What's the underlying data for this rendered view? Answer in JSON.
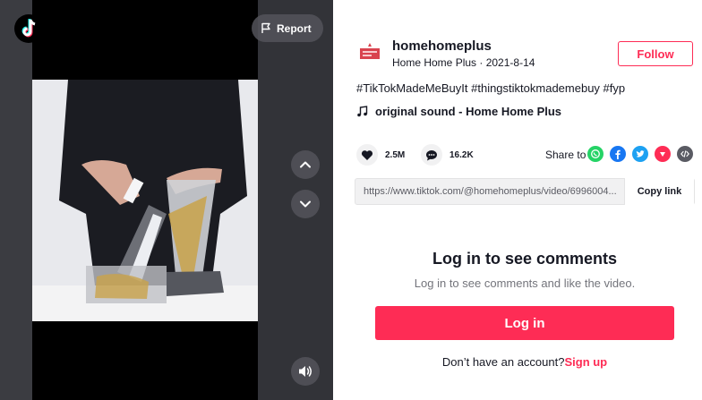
{
  "video": {
    "report_label": "Report",
    "logo_icon": "tiktok-logo-icon",
    "nav_up_icon": "chevron-up-icon",
    "nav_down_icon": "chevron-down-icon",
    "volume_icon": "volume-icon"
  },
  "author": {
    "username": "homehomeplus",
    "display_name": "Home Home Plus",
    "date": "2021-8-14",
    "separator": " · "
  },
  "follow_label": "Follow",
  "caption": "#TikTokMadeMeBuyIt #thingstiktokmademebuy #fyp",
  "music": {
    "icon": "music-note-icon",
    "title": "original sound - Home Home Plus"
  },
  "stats": {
    "likes": "2.5M",
    "comments": "16.2K"
  },
  "share": {
    "label": "Share to",
    "targets": [
      "whatsapp-icon",
      "facebook-icon",
      "twitter-icon",
      "pinterest-icon",
      "embed-icon"
    ]
  },
  "link": {
    "url": "https://www.tiktok.com/@homehomeplus/video/6996004...",
    "copy_label": "Copy link"
  },
  "comments": {
    "title": "Log in to see comments",
    "subtitle": "Log in to see comments and like the video.",
    "login_label": "Log in",
    "signup_prompt": "Don’t have an account?",
    "signup_label": "Sign up"
  },
  "colors": {
    "accent": "#fe2c55",
    "whatsapp": "#25d366",
    "facebook": "#1877f2",
    "twitter": "#1da1f2",
    "pinterest": "#fe2c55",
    "embed": "#5a5b63"
  }
}
